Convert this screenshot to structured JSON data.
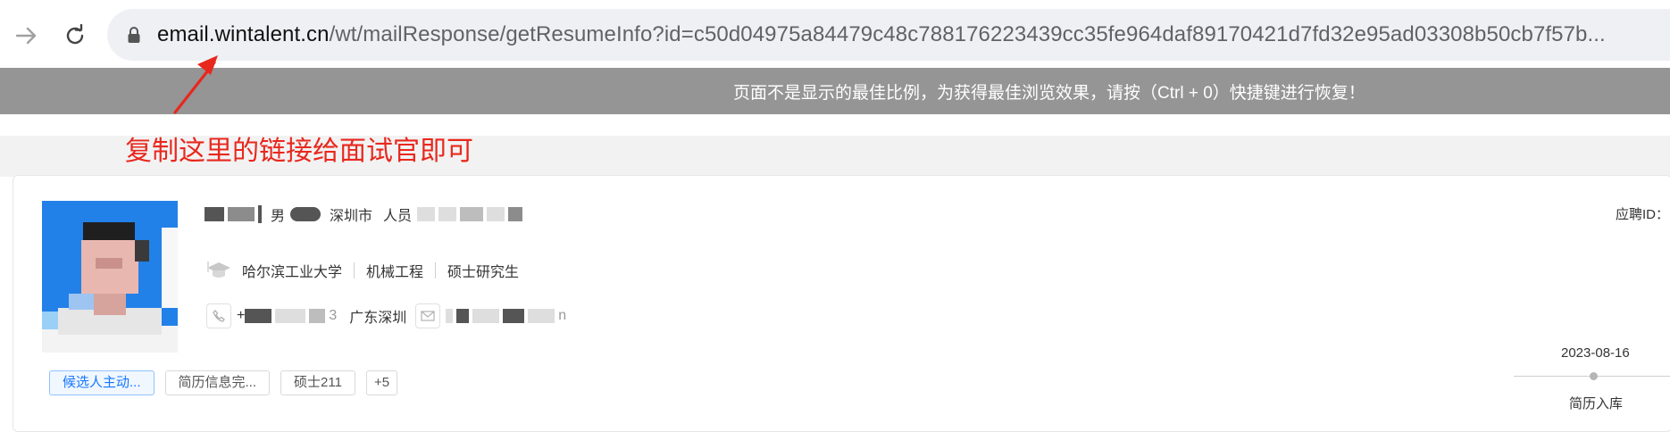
{
  "browser": {
    "url_host": "email.wintalent.cn",
    "url_path": "/wt/mailResponse/getResumeInfo?id=c50d04975a84479c48c788176223439cc35fe964daf89170421d7fd32e95ad03308b50cb7f57b..."
  },
  "notice": {
    "text": "页面不是显示的最佳比例，为获得最佳浏览效果，请按（Ctrl + 0）快捷键进行恢复！"
  },
  "annotation": {
    "text": "复制这里的链接给面试官即可",
    "color": "#e8281e"
  },
  "candidate": {
    "gender": "男",
    "city": "深圳市",
    "status_prefix": "人员",
    "apply_id_label": "应聘ID：",
    "education": {
      "school": "哈尔滨工业大学",
      "major": "机械工程",
      "degree": "硕士研究生"
    },
    "phone_prefix": "+",
    "phone_suffix": "3",
    "location": "广东深圳",
    "email_tail": "n"
  },
  "tags": [
    "候选人主动...",
    "简历信息完...",
    "硕士211",
    "+5"
  ],
  "timeline": {
    "date": "2023-08-16",
    "label": "简历入库"
  }
}
